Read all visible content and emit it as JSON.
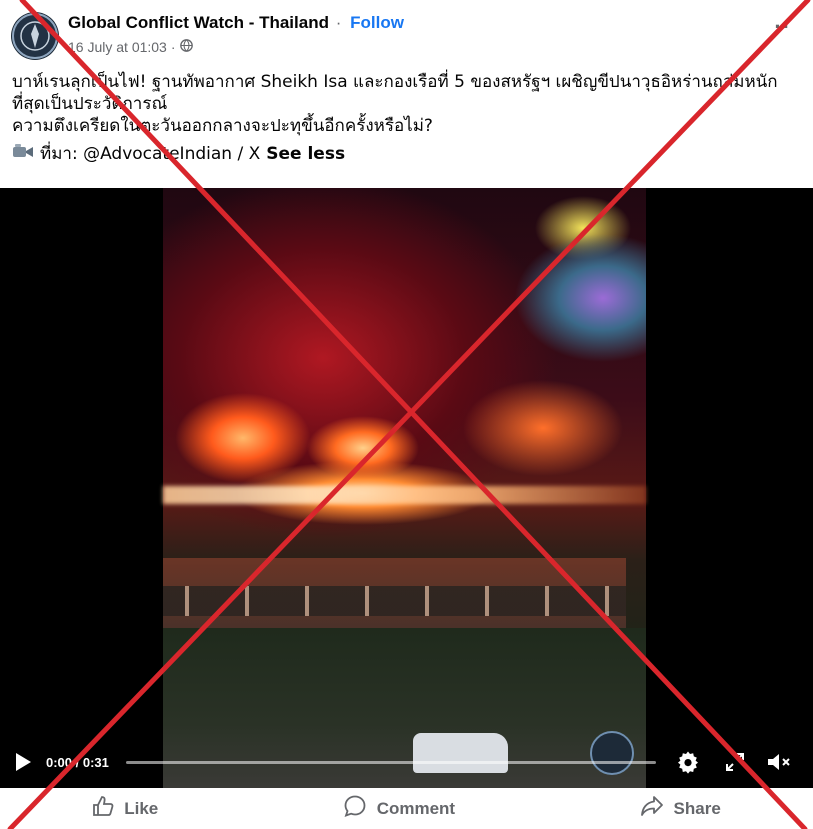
{
  "post": {
    "page_name": "Global Conflict Watch - Thailand",
    "separator": "·",
    "follow_label": "Follow",
    "timestamp": "16 July at 01:03",
    "timestamp_separator": "·",
    "audience_icon": "globe-icon",
    "more_icon": "more-options-icon",
    "text_line1": "บาห์เรนลุกเป็นไฟ! ฐานทัพอากาศ Sheikh Isa และกองเรือที่ 5 ของสหรัฐฯ เผชิญขีปนาวุธอิหร่านถล่มหนัก",
    "text_line2": "ที่สุดเป็นประวัติการณ์",
    "text_line3": "ความตึงเครียดในตะวันออกกลางจะปะทุขึ้นอีกครั้งหรือไม่?",
    "source_icon": "video-camera-icon",
    "source_text": "ที่มา: @AdvocateIndian / X",
    "see_less": "See less"
  },
  "video": {
    "time_display": "0:00 / 0:31",
    "progress": 0.0,
    "play_icon": "play-icon",
    "settings_icon": "gear-icon",
    "fullscreen_icon": "fullscreen-icon",
    "mute_icon": "muted-speaker-icon"
  },
  "actions": {
    "like_label": "Like",
    "comment_label": "Comment",
    "share_label": "Share"
  },
  "overlay": {
    "cross_color": "#d9262c",
    "meaning": "red-x-cross-mark"
  },
  "colors": {
    "link_blue": "#1877f2",
    "secondary_text": "#65676b"
  }
}
